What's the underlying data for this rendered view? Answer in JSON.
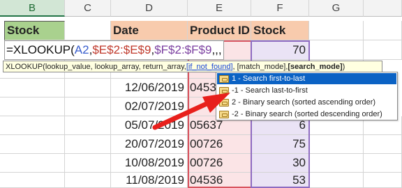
{
  "columns": [
    "B",
    "C",
    "D",
    "E",
    "F",
    "G"
  ],
  "headers": {
    "b": "Stock",
    "d": "Date",
    "e": "Product ID",
    "f": "Stock"
  },
  "formula": {
    "p1": "=XLOOKUP(",
    "p2": "A2",
    "p3": ",",
    "p4": "$E$2:$E$9",
    "p5": ",",
    "p6": "$F$2:$F$9",
    "p7": ",,,"
  },
  "f2_value": "70",
  "tooltip": {
    "pre": "XLOOKUP(lookup_value, lookup_array, return_array, ",
    "cur": "[if_not_found]",
    "mid": ", [match_mode], ",
    "last": "[search_mode]",
    "end": ")"
  },
  "dropdown": [
    "1 - Search first-to-last",
    "-1 - Search last-to-first",
    "2 - Binary search (sorted ascending order)",
    "-2 - Binary search (sorted descending order)"
  ],
  "rows": [
    {
      "d": "",
      "e": "",
      "f": ""
    },
    {
      "d": "12/06/2019",
      "e": "0453",
      "f": ""
    },
    {
      "d": "02/07/2019",
      "e": "",
      "f": ""
    },
    {
      "d": "05/07/2019",
      "e": "05637",
      "f": "6"
    },
    {
      "d": "20/07/2019",
      "e": "00726",
      "f": "75"
    },
    {
      "d": "10/08/2019",
      "e": "00726",
      "f": "30"
    },
    {
      "d": "11/08/2019",
      "e": "04536",
      "f": "53"
    }
  ],
  "colors": {
    "green": "#a9d18e",
    "peach": "#f8cbad",
    "pink": "#fbe4e6",
    "lavender": "#eae3f5",
    "arrow": "#e8201c",
    "selected": "#0b62c4"
  }
}
